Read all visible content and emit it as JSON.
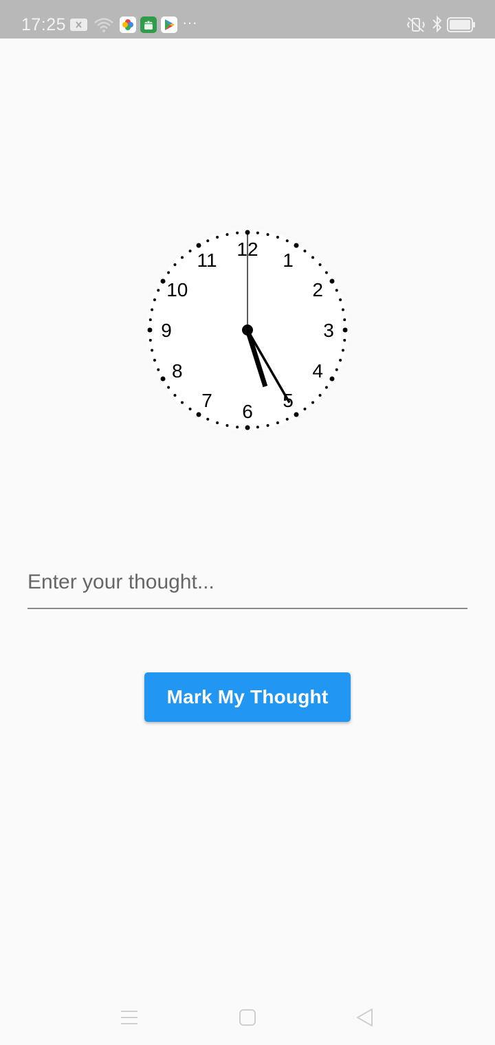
{
  "status_bar": {
    "time": "17:25",
    "more_indicator": "···",
    "icons": [
      "notification-x-icon",
      "wifi-icon",
      "photos-app-icon",
      "android-app-icon",
      "play-store-icon",
      "vibrate-off-icon",
      "bluetooth-icon",
      "battery-icon"
    ]
  },
  "clock": {
    "numerals": [
      "12",
      "1",
      "2",
      "3",
      "4",
      "5",
      "6",
      "7",
      "8",
      "9",
      "10",
      "11"
    ],
    "time_shown": {
      "hour": 5,
      "minute": 25,
      "second": 0
    }
  },
  "input": {
    "placeholder": "Enter your thought...",
    "value": ""
  },
  "button": {
    "label": "Mark My Thought",
    "color": "#2196f3"
  },
  "nav_bar": {
    "buttons": [
      "menu-icon",
      "home-icon",
      "back-icon"
    ]
  }
}
